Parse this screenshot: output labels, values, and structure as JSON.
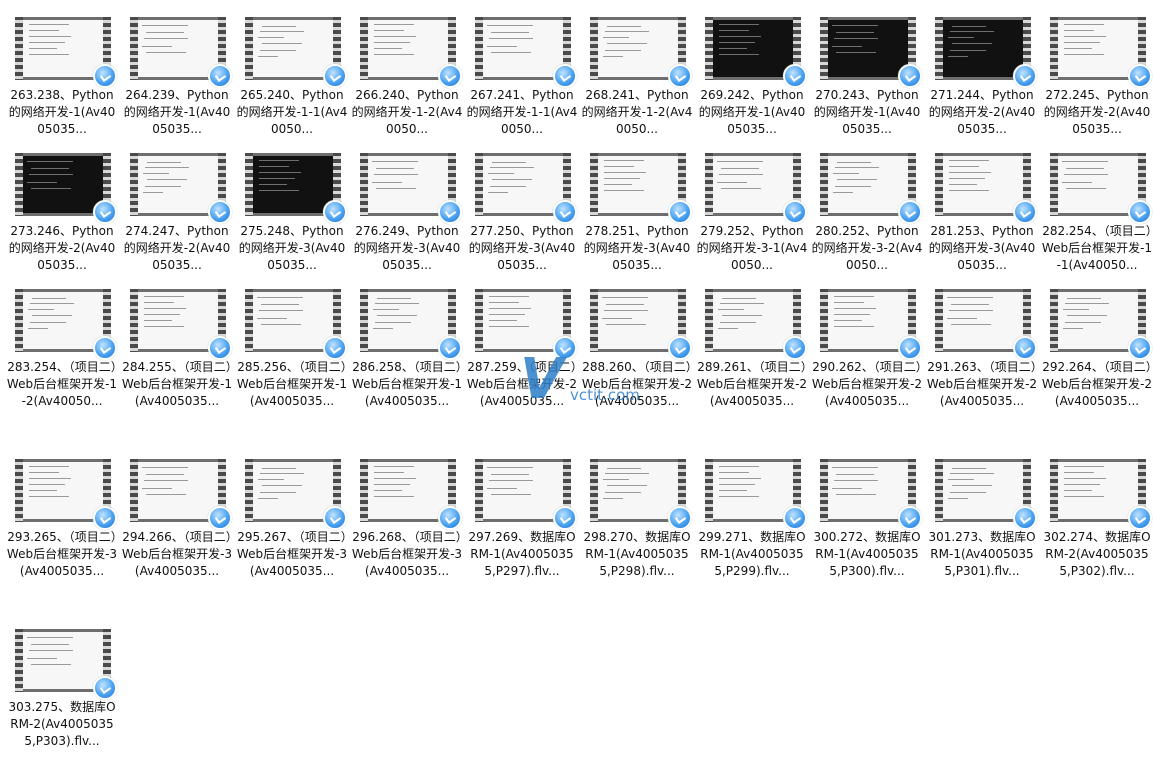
{
  "files": [
    {
      "label": "263.238、Python的网络开发-1(Av4005035...",
      "dark": false
    },
    {
      "label": "264.239、Python的网络开发-1(Av4005035...",
      "dark": false
    },
    {
      "label": "265.240、Python的网络开发-1-1(Av40050...",
      "dark": false
    },
    {
      "label": "266.240、Python的网络开发-1-2(Av40050...",
      "dark": false
    },
    {
      "label": "267.241、Python的网络开发-1-1(Av40050...",
      "dark": false
    },
    {
      "label": "268.241、Python的网络开发-1-2(Av40050...",
      "dark": false
    },
    {
      "label": "269.242、Python的网络开发-1(Av4005035...",
      "dark": true
    },
    {
      "label": "270.243、Python的网络开发-1(Av4005035...",
      "dark": true
    },
    {
      "label": "271.244、Python的网络开发-2(Av4005035...",
      "dark": true
    },
    {
      "label": "272.245、Python的网络开发-2(Av4005035...",
      "dark": false
    },
    {
      "label": "273.246、Python的网络开发-2(Av4005035...",
      "dark": true
    },
    {
      "label": "274.247、Python的网络开发-2(Av4005035...",
      "dark": false
    },
    {
      "label": "275.248、Python的网络开发-3(Av4005035...",
      "dark": true
    },
    {
      "label": "276.249、Python的网络开发-3(Av4005035...",
      "dark": false
    },
    {
      "label": "277.250、Python的网络开发-3(Av4005035...",
      "dark": false
    },
    {
      "label": "278.251、Python的网络开发-3(Av4005035...",
      "dark": false
    },
    {
      "label": "279.252、Python的网络开发-3-1(Av40050...",
      "dark": false
    },
    {
      "label": "280.252、Python的网络开发-3-2(Av40050...",
      "dark": false
    },
    {
      "label": "281.253、Python的网络开发-3(Av4005035...",
      "dark": false
    },
    {
      "label": "282.254、（项目二）Web后台框架开发-1-1(Av40050...",
      "dark": false
    },
    {
      "label": "283.254、（项目二）Web后台框架开发-1-2(Av40050...",
      "dark": false
    },
    {
      "label": "284.255、（项目二）Web后台框架开发-1(Av4005035...",
      "dark": false
    },
    {
      "label": "285.256、（项目二）Web后台框架开发-1(Av4005035...",
      "dark": false
    },
    {
      "label": "286.258、（项目二）Web后台框架开发-1(Av4005035...",
      "dark": false
    },
    {
      "label": "287.259、（项目二）Web后台框架开发-2(Av4005035...",
      "dark": false
    },
    {
      "label": "288.260、（项目二）Web后台框架开发-2(Av4005035...",
      "dark": false
    },
    {
      "label": "289.261、（项目二）Web后台框架开发-2(Av4005035...",
      "dark": false
    },
    {
      "label": "290.262、（项目二）Web后台框架开发-2(Av4005035...",
      "dark": false
    },
    {
      "label": "291.263、（项目二）Web后台框架开发-2(Av4005035...",
      "dark": false
    },
    {
      "label": "292.264、（项目二）Web后台框架开发-2(Av4005035...",
      "dark": false
    },
    {
      "label": "293.265、（项目二）Web后台框架开发-3(Av4005035...",
      "dark": false
    },
    {
      "label": "294.266、（项目二）Web后台框架开发-3(Av4005035...",
      "dark": false
    },
    {
      "label": "295.267、（项目二）Web后台框架开发-3(Av4005035...",
      "dark": false
    },
    {
      "label": "296.268、（项目二）Web后台框架开发-3(Av4005035...",
      "dark": false
    },
    {
      "label": "297.269、数据库ORM-1(Av40050355,P297).flv...",
      "dark": false
    },
    {
      "label": "298.270、数据库ORM-1(Av40050355,P298).flv...",
      "dark": false
    },
    {
      "label": "299.271、数据库ORM-1(Av40050355,P299).flv...",
      "dark": false
    },
    {
      "label": "300.272、数据库ORM-1(Av40050355,P300).flv...",
      "dark": false
    },
    {
      "label": "301.273、数据库ORM-1(Av40050355,P301).flv...",
      "dark": false
    },
    {
      "label": "302.274、数据库ORM-2(Av40050355,P302).flv...",
      "dark": false
    },
    {
      "label": "303.275、数据库ORM-2(Av40050355,P303).flv...",
      "dark": false
    }
  ],
  "watermark": {
    "mark": "V",
    "text": "vctit.com"
  },
  "colors": {
    "badge": "#4aa3f0",
    "watermark": "#2f7fc8"
  }
}
